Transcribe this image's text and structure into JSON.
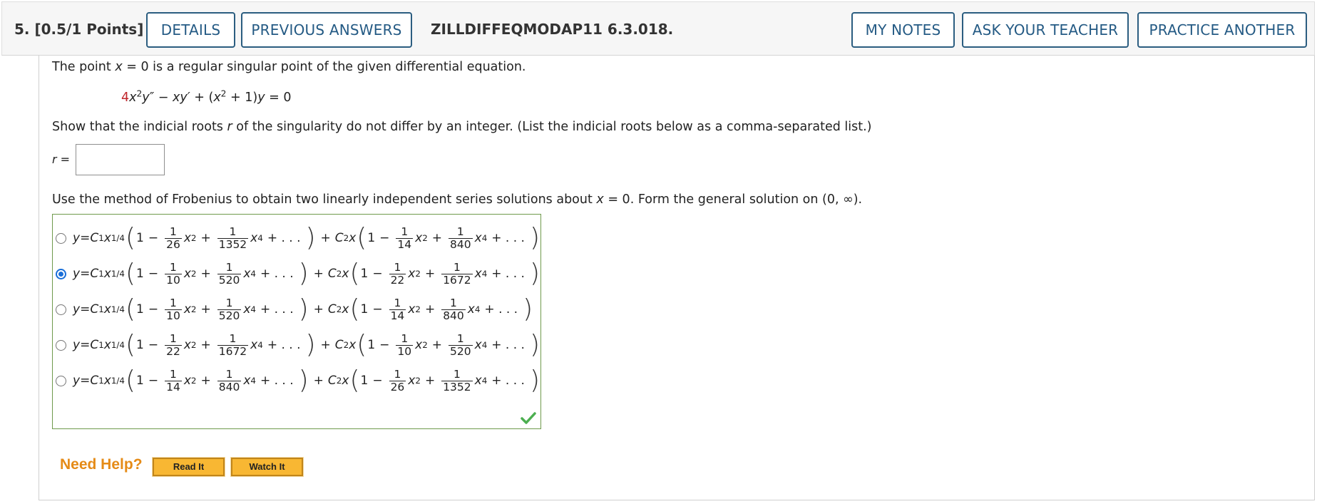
{
  "header": {
    "points": "5. [0.5/1 Points]",
    "details_label": "DETAILS",
    "previous_answers_label": "PREVIOUS ANSWERS",
    "question_code": "ZILLDIFFEQMODAP11 6.3.018.",
    "my_notes_label": "MY NOTES",
    "ask_teacher_label": "ASK YOUR TEACHER",
    "practice_another_label": "PRACTICE ANOTHER"
  },
  "problem": {
    "intro_a": "The point ",
    "intro_x": "x",
    "intro_b": " = 0 is a regular singular point of the given differential equation.",
    "equation": {
      "coef": "4",
      "x1": "x",
      "exp1": "2",
      "y1": "y″",
      "minus": " − ",
      "xy": "xy′",
      "plus_paren": " + (",
      "x2": "x",
      "exp2": "2",
      "rest": " + 1)",
      "y2": "y",
      "eq": " = 0"
    },
    "show_a": "Show that the indicial roots ",
    "show_r": "r",
    "show_b": " of the singularity do not differ by an integer. (List the indicial roots below as a comma-separated list.)",
    "r_label": "r =",
    "r_value": "",
    "method_a": "Use the method of Frobenius to obtain two linearly independent series solutions about ",
    "method_x": "x",
    "method_b": " = 0. Form the general solution on (0, ∞)."
  },
  "choices": [
    {
      "d1": "26",
      "d2": "1352",
      "d3": "14",
      "d4": "840",
      "selected": false
    },
    {
      "d1": "10",
      "d2": "520",
      "d3": "22",
      "d4": "1672",
      "selected": true
    },
    {
      "d1": "10",
      "d2": "520",
      "d3": "14",
      "d4": "840",
      "selected": false
    },
    {
      "d1": "22",
      "d2": "1672",
      "d3": "10",
      "d4": "520",
      "selected": false
    },
    {
      "d1": "14",
      "d2": "840",
      "d3": "26",
      "d4": "1352",
      "selected": false
    }
  ],
  "formula_parts": {
    "y": "y",
    "eq": " = ",
    "c1": "C",
    "c1_sub": "1",
    "x": "x",
    "exp_quarter": "1/4",
    "one": "1",
    "minus": "−",
    "plus": "+",
    "num": "1",
    "exp2": "2",
    "exp4": "4",
    "ellipsis": "+ . . .",
    "c2": "C",
    "c2_sub": "2"
  },
  "status": {
    "correct_icon": "checkmark-icon",
    "check_color": "#4caf50"
  },
  "help": {
    "need_help": "Need Help?",
    "read_it": "Read It",
    "watch_it": "Watch It"
  }
}
